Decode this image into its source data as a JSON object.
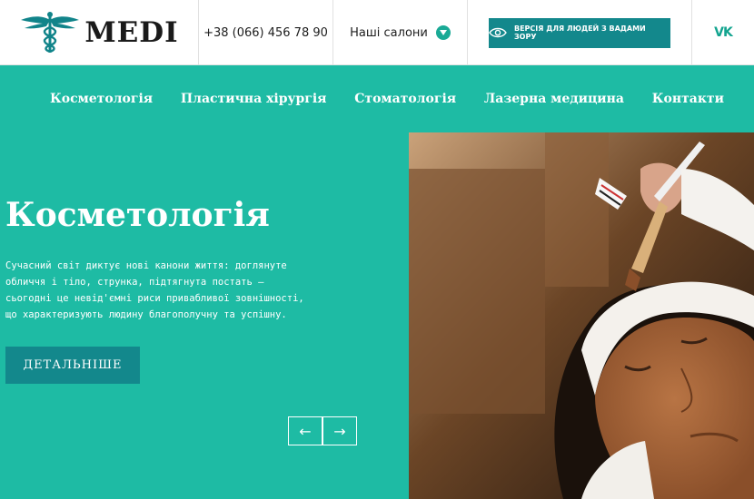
{
  "header": {
    "logo_text": "MEDI",
    "phone": "+38 (066) 456 78 90",
    "salons_label": "Наші салони",
    "accessibility_label": "Версія для людей з вадами зору",
    "vk_label": "VK"
  },
  "nav": {
    "items": [
      {
        "label": "Косметологія"
      },
      {
        "label": "Пластична хірургія"
      },
      {
        "label": "Стоматологія"
      },
      {
        "label": "Лазерна медицина"
      },
      {
        "label": "Контакти"
      }
    ]
  },
  "hero": {
    "title": "Косметологія",
    "description": "Сучасний світ диктує нові канони життя: доглянуте обличчя і тіло, струнка, підтягнута постать — сьогодні це невід'ємні риси привабливої зовнішності, що характеризують людину благополучну та успішну.",
    "more_button": "Детальніше",
    "prev_arrow": "←",
    "next_arrow": "→"
  },
  "colors": {
    "brand_teal": "#1ebba4",
    "button_dark_teal": "#13888c",
    "logo_teal": "#11848a"
  },
  "icons": {
    "logo": "caduceus-icon",
    "accessibility": "eye-icon",
    "dropdown": "chevron-down-icon"
  }
}
